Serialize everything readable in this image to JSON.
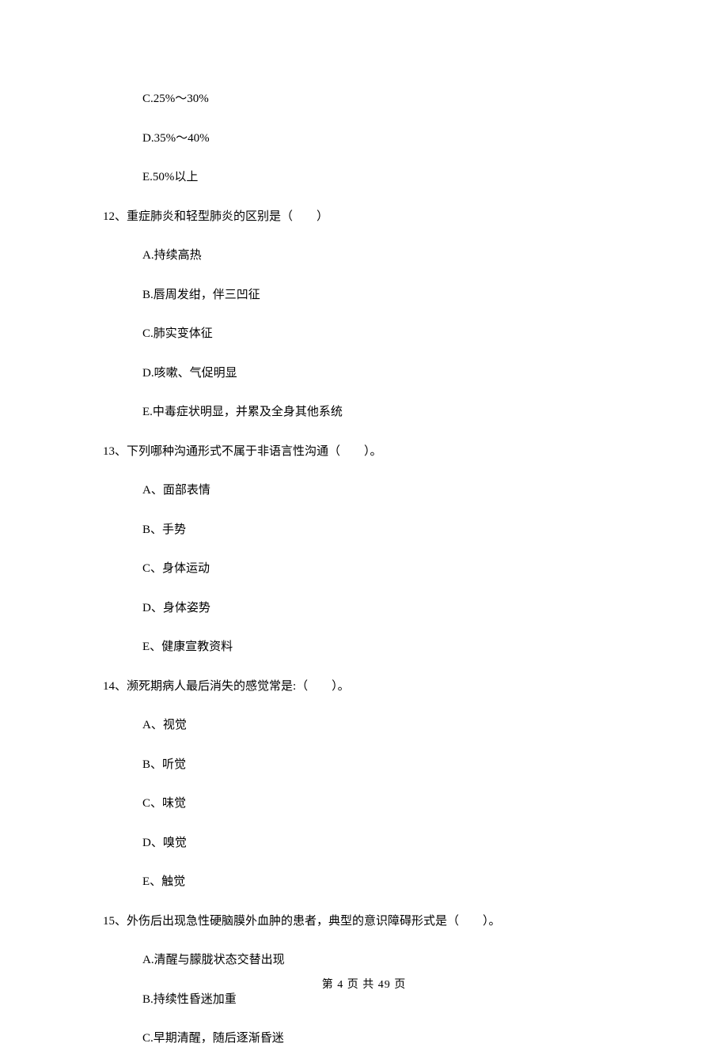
{
  "options_top": [
    "C.25%～30%",
    "D.35%～40%",
    "E.50%以上"
  ],
  "questions": [
    {
      "number": "12、",
      "stem": "重症肺炎和轻型肺炎的区别是（　　）",
      "options": [
        "A.持续高热",
        "B.唇周发绀，伴三凹征",
        "C.肺实变体征",
        "D.咳嗽、气促明显",
        "E.中毒症状明显，并累及全身其他系统"
      ]
    },
    {
      "number": "13、",
      "stem": "下列哪种沟通形式不属于非语言性沟通（　　）。",
      "options": [
        "A、面部表情",
        "B、手势",
        "C、身体运动",
        "D、身体姿势",
        "E、健康宣教资料"
      ]
    },
    {
      "number": "14、",
      "stem": "濒死期病人最后消失的感觉常是:（　　）。",
      "options": [
        "A、视觉",
        "B、听觉",
        "C、味觉",
        "D、嗅觉",
        "E、触觉"
      ]
    },
    {
      "number": "15、",
      "stem": "外伤后出现急性硬脑膜外血肿的患者，典型的意识障碍形式是（　　）。",
      "options": [
        "A.清醒与朦胧状态交替出现",
        "B.持续性昏迷加重",
        "C.早期清醒，随后逐渐昏迷"
      ]
    }
  ],
  "footer": "第 4 页 共 49 页"
}
